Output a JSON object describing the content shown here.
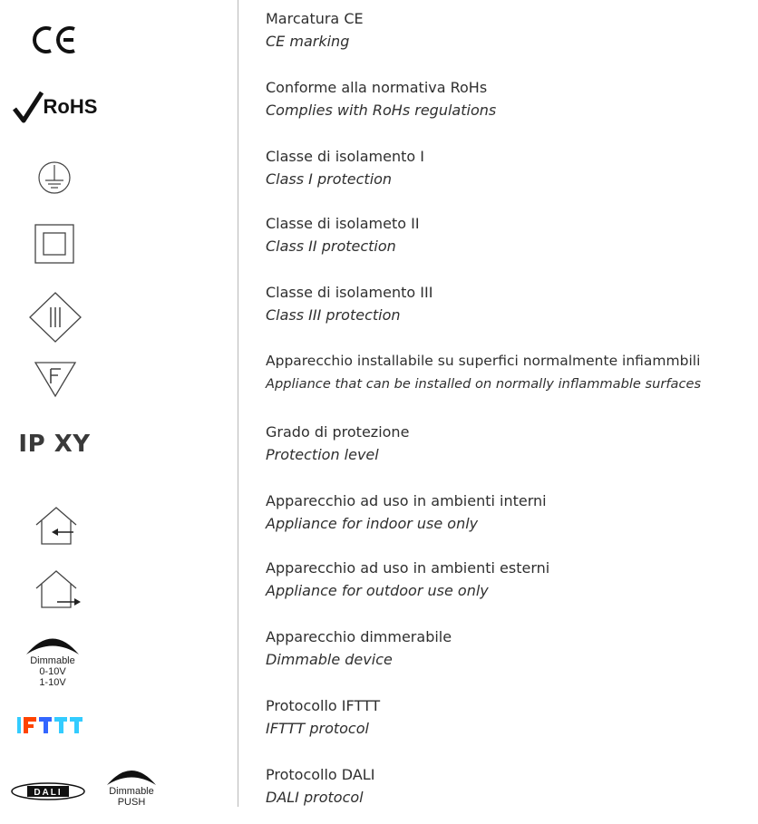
{
  "icons": {
    "ce": "ce-marking-icon",
    "rohs": "RoHS",
    "ip": "IP XY",
    "dimmable": {
      "label": "Dimmable",
      "line1": "0-10V",
      "line2": "1-10V"
    },
    "dali": {
      "badge": "DALI",
      "label": "Dimmable",
      "sub": "PUSH"
    }
  },
  "rows": [
    {
      "it": "Marcatura CE",
      "en": "CE marking"
    },
    {
      "it": "Conforme alla normativa RoHs",
      "en": "Complies with RoHs regulations"
    },
    {
      "it": "Classe di isolamento I",
      "en": "Class I protection"
    },
    {
      "it": "Classe di isolameto II",
      "en": "Class II protection"
    },
    {
      "it": "Classe di isolamento III",
      "en": "Class III protection"
    },
    {
      "it": "Apparecchio installabile su superfici normalmente infiammbili",
      "en": "Appliance that can be installed on normally inflammable surfaces"
    },
    {
      "it": "Grado di protezione",
      "en": "Protection level"
    },
    {
      "it": "Apparecchio ad uso in ambienti interni",
      "en": "Appliance for indoor use only"
    },
    {
      "it": "Apparecchio ad uso in ambienti esterni",
      "en": "Appliance for outdoor use only"
    },
    {
      "it": "Apparecchio dimmerabile",
      "en": "Dimmable device"
    },
    {
      "it": "Protocollo IFTTT",
      "en": "IFTTT protocol"
    },
    {
      "it": "Protocollo DALI",
      "en": "DALI protocol"
    }
  ]
}
